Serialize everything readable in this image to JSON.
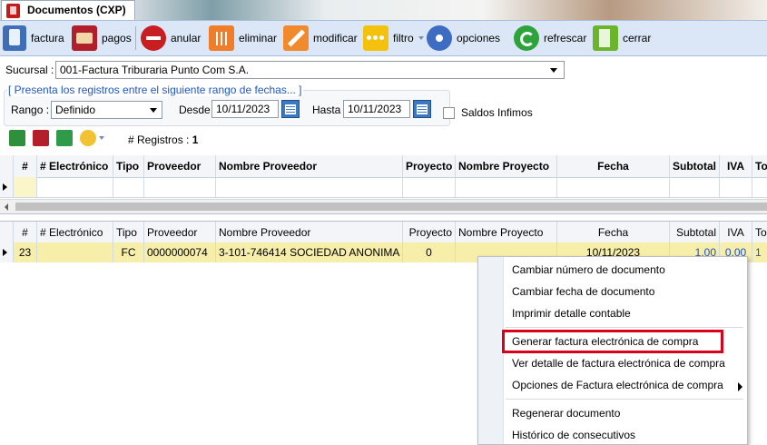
{
  "tab": {
    "title": "Documentos (CXP)"
  },
  "toolbar": {
    "factura": "factura",
    "pagos": "pagos",
    "anular": "anular",
    "eliminar": "eliminar",
    "modificar": "modificar",
    "filtro": "filtro",
    "opciones": "opciones",
    "refrescar": "refrescar",
    "cerrar": "cerrar"
  },
  "form": {
    "sucursal_label": "Sucursal :",
    "sucursal_value": "001-Factura Triburaria Punto Com S.A.",
    "range_title": "[ Presenta los registros entre el siguiente rango de fechas... ]",
    "rango_label": "Rango :",
    "rango_value": "Definido",
    "desde_label": "Desde",
    "desde_value": "10/11/2023",
    "hasta_label": "Hasta",
    "hasta_value": "10/11/2023",
    "saldos_label": "Saldos Infimos"
  },
  "records": {
    "label": "# Registros :",
    "count": "1"
  },
  "columns": {
    "num": "#",
    "electronico": "# Electrónico",
    "tipo": "Tipo",
    "proveedor": "Proveedor",
    "nombre_proveedor": "Nombre Proveedor",
    "proyecto": "Proyecto",
    "nombre_proyecto": "Nombre Proyecto",
    "fecha": "Fecha",
    "subtotal": "Subtotal",
    "iva": "IVA",
    "total": "To"
  },
  "rows": [
    {
      "num": "23",
      "electronico": "",
      "tipo": "FC",
      "proveedor": "0000000074",
      "nombre_proveedor": "3-101-746414 SOCIEDAD ANONIMA",
      "proyecto": "0",
      "nombre_proyecto": "",
      "fecha": "10/11/2023",
      "subtotal": "1.00",
      "iva": "0.00",
      "total": "1"
    }
  ],
  "context_menu": {
    "items": [
      "Cambiar número de documento",
      "Cambiar fecha de documento",
      "Imprimir detalle contable",
      "Generar factura electrónica de compra",
      "Ver detalle de factura electrónica de compra",
      "Opciones de Factura electrónica de compra",
      "Regenerar documento",
      "Histórico de consecutivos"
    ]
  },
  "colors": {
    "toolbar_bg": "#dbe7f7",
    "row_highlight": "#f6eea9",
    "link_blue": "#1d4fd1",
    "highlight_border": "#d9001b"
  }
}
